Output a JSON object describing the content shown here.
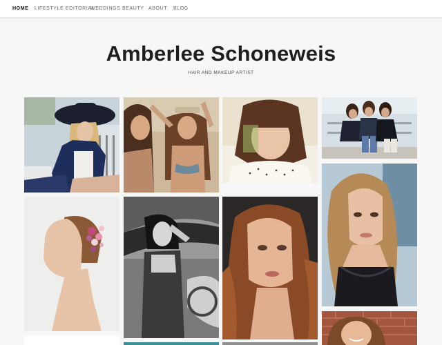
{
  "nav": {
    "items": [
      {
        "label": "HOME",
        "active": true
      },
      {
        "label": "LIFESTYLE EDITORIAL",
        "active": false
      },
      {
        "label": "WEDDINGS",
        "active": false
      },
      {
        "label": "BEAUTY",
        "active": false
      },
      {
        "label": "ABOUT",
        "active": false
      },
      {
        "label": "BLOG",
        "active": false
      }
    ]
  },
  "header": {
    "title": "Amberlee Schoneweis",
    "tagline": "HAIR AND MAKEUP ARTIST"
  },
  "gallery": {
    "photos": [
      "woman-wide-brim-hat-photo",
      "two-women-beach-photo",
      "woman-bob-haircut-photo",
      "three-friends-sitting-photo",
      "woman-flower-hairpiece-photo",
      "woman-in-car-bw-photo",
      "woman-beauty-portrait-photo",
      "woman-long-wavy-hair-photo",
      "woman-smiling-brick-wall-photo"
    ]
  },
  "colors": {
    "background": "#f7f7f7",
    "nav_background": "#ffffff",
    "title": "#1e1e1e"
  }
}
